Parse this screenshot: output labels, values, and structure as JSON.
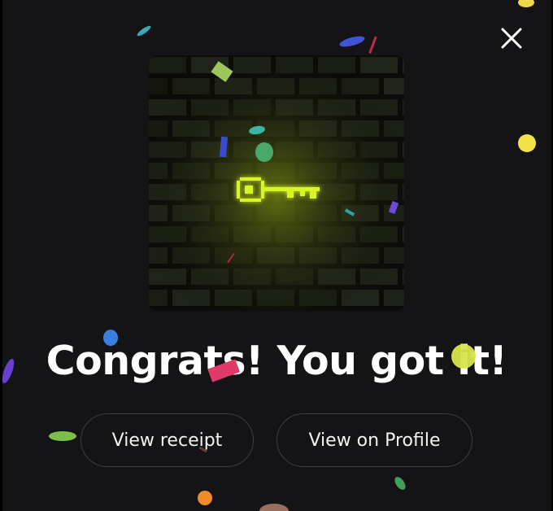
{
  "modal": {
    "headline": "Congrats! You got it!",
    "close_icon": "close-icon",
    "artwork_icon": "pixel-key-icon"
  },
  "actions": {
    "view_receipt_label": "View receipt",
    "view_profile_label": "View on Profile"
  },
  "colors": {
    "background": "#141416",
    "button_border": "#3b3e44",
    "key_glow": "#d9f525",
    "text": "#ffffff"
  }
}
